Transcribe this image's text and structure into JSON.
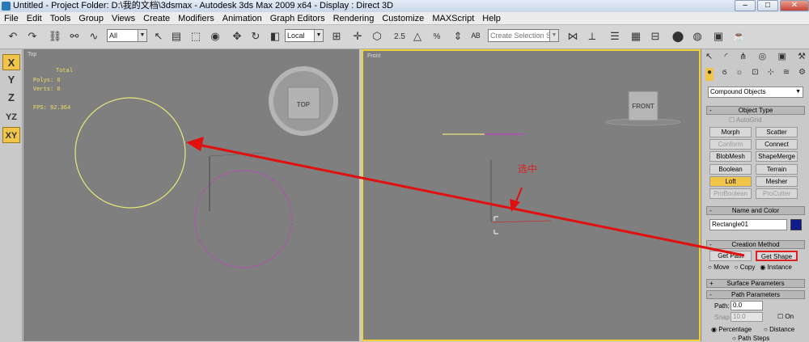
{
  "title_bar": {
    "text": "Untitled    - Project Folder: D:\\我的文档\\3dsmax    - Autodesk 3ds Max  2009 x64    - Display : Direct 3D",
    "buttons": [
      "–",
      "□",
      "✕"
    ]
  },
  "menu": [
    "File",
    "Edit",
    "Tools",
    "Group",
    "Views",
    "Create",
    "Modifiers",
    "Animation",
    "Graph Editors",
    "Rendering",
    "Customize",
    "MAXScript",
    "Help"
  ],
  "toolbar": {
    "selection_filter": "All",
    "reference_coord": "Local",
    "named_selection_placeholder": "Create Selection Set",
    "snap_labels": [
      "2.5",
      "3",
      "%"
    ]
  },
  "axis_constraints": [
    "X",
    "Y",
    "Z",
    "YZ",
    "XY"
  ],
  "viewport_top": {
    "label": "Top",
    "stats": {
      "header": "Total",
      "polys": "Polys: 0",
      "verts": "Verts: 0",
      "fps": "FPS:   92.364"
    },
    "viewcube": "TOP"
  },
  "viewport_front": {
    "label": "Front",
    "viewcube": "FRONT",
    "annotation": "选中"
  },
  "command_panel": {
    "category": "Compound Objects",
    "object_type_header": "Object Type",
    "autogrid": "AutoGrid",
    "buttons": [
      [
        "Morph",
        "Scatter"
      ],
      [
        "Conform",
        "Connect"
      ],
      [
        "BlobMesh",
        "ShapeMerge"
      ],
      [
        "Boolean",
        "Terrain"
      ],
      [
        "Loft",
        "Mesher"
      ],
      [
        "ProBoolean",
        "ProCutter"
      ]
    ],
    "disabled": [
      "Conform",
      "ProBoolean",
      "ProCutter"
    ],
    "active": "Loft",
    "name_color_header": "Name and Color",
    "object_name": "Rectangle01",
    "object_color": "#101a8a",
    "creation_method_header": "Creation Method",
    "get_path": "Get Path",
    "get_shape": "Get Shape",
    "radio_options": [
      "Move",
      "Copy",
      "Instance"
    ],
    "radio_selected": "Instance",
    "surface_params": "Surface Parameters",
    "path_params": "Path Parameters",
    "path_label": "Path:",
    "path_value": "0.0",
    "snap_label": "Snap",
    "snap_value": "10.0",
    "on_label": "On",
    "percentage": "Percentage",
    "distance": "Distance",
    "path_steps": "Path Steps"
  }
}
